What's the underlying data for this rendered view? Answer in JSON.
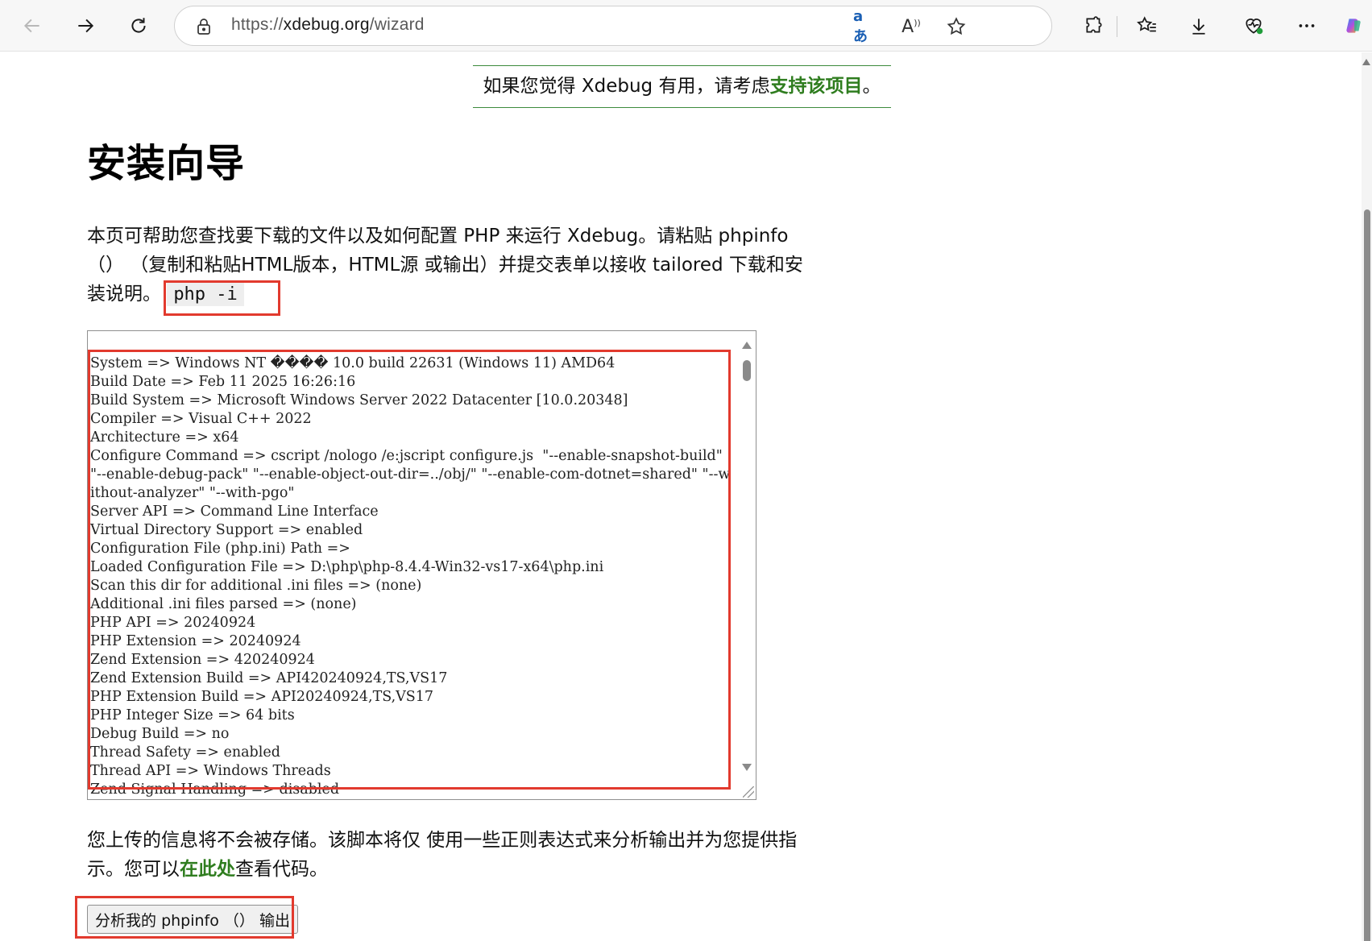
{
  "browser": {
    "url_scheme": "https://",
    "url_host": "xdebug.org",
    "url_path": "/wizard",
    "translate_icon_text": "aあ",
    "read_aloud_icon_text": "A",
    "toolbar_icons": [
      "back-icon",
      "forward-icon",
      "refresh-icon",
      "lock-icon",
      "translate-icon",
      "read-aloud-icon",
      "favorite-star-icon",
      "extensions-icon",
      "favorites-icon",
      "downloads-icon",
      "browser-health-icon",
      "more-icon",
      "copilot-icon"
    ]
  },
  "banner": {
    "text": "如果您觉得 Xdebug 有用，请考虑",
    "link": "支持该项目",
    "suffix": "。"
  },
  "page": {
    "title": "安装向导",
    "intro_part1": "本页可帮助您查找要下载的文件以及如何配置 PHP 来运行 Xdebug。请粘贴 phpinfo （） （复制和粘贴HTML版本，HTML源 或输出）并提交表单以接收 tailored 下载和安装说明。",
    "intro_code": "php -i",
    "phpinfo_output": "System => Windows NT ���� 10.0 build 22631 (Windows 11) AMD64\nBuild Date => Feb 11 2025 16:26:16\nBuild System => Microsoft Windows Server 2022 Datacenter [10.0.20348]\nCompiler => Visual C++ 2022\nArchitecture => x64\nConfigure Command => cscript /nologo /e:jscript configure.js  \"--enable-snapshot-build\" \"--enable-debug-pack\" \"--enable-object-out-dir=../obj/\" \"--enable-com-dotnet=shared\" \"--without-analyzer\" \"--with-pgo\"\nServer API => Command Line Interface\nVirtual Directory Support => enabled\nConfiguration File (php.ini) Path =>\nLoaded Configuration File => D:\\php\\php-8.4.4-Win32-vs17-x64\\php.ini\nScan this dir for additional .ini files => (none)\nAdditional .ini files parsed => (none)\nPHP API => 20240924\nPHP Extension => 20240924\nZend Extension => 420240924\nZend Extension Build => API420240924,TS,VS17\nPHP Extension Build => API20240924,TS,VS17\nPHP Integer Size => 64 bits\nDebug Build => no\nThread Safety => enabled\nThread API => Windows Threads\nZend Signal Handling => disabled",
    "notice_part1": "您上传的信息将不会被存储。该脚本将仅 使用一些正则表达式来分析输出并为您提供指示。您可以",
    "notice_link": "在此处",
    "notice_part2": "查看代码。",
    "submit_label": "分析我的 phpinfo （） 输出"
  },
  "colors": {
    "accent_green": "#2f7d1f",
    "annotation_red": "#e23a2e"
  }
}
